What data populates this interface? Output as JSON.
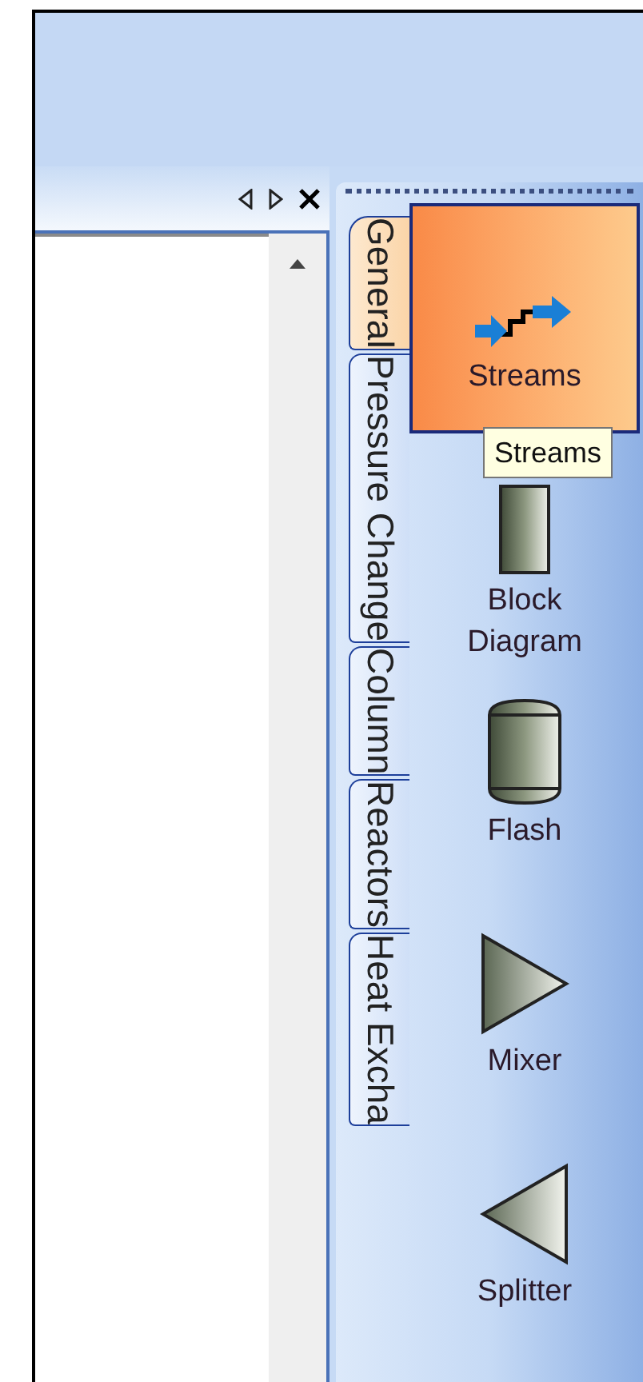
{
  "palette": {
    "tabs": [
      {
        "label": "General",
        "selected": true
      },
      {
        "label": "Pressure Change",
        "selected": false
      },
      {
        "label": "Column",
        "selected": false
      },
      {
        "label": "Reactors",
        "selected": false
      },
      {
        "label": "Heat Excha",
        "selected": false
      }
    ],
    "items": [
      {
        "label": "Streams",
        "kind": "streams",
        "selected": true
      },
      {
        "label": "Block Diagram",
        "kind": "block",
        "selected": false
      },
      {
        "label": "Flash",
        "kind": "flash",
        "selected": false
      },
      {
        "label": "Mixer",
        "kind": "mixer",
        "selected": false
      },
      {
        "label": "Splitter",
        "kind": "splitter",
        "selected": false
      }
    ],
    "tooltip": "Streams"
  }
}
